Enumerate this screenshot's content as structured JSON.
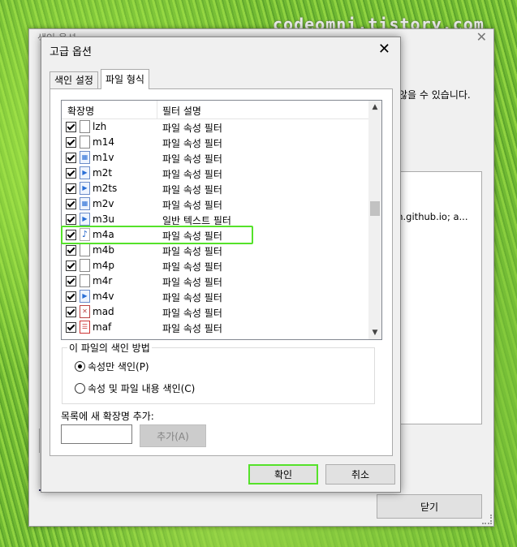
{
  "watermark": "codeomni.tistory.com",
  "background_window": {
    "title": "색인 옵션",
    "description_fragment": "않을 수 있습니다.",
    "list_fragment": "ian.github.io; a...",
    "close_button": "닫기"
  },
  "dialog": {
    "title": "고급 옵션",
    "tabs": [
      {
        "label": "색인 설정",
        "active": false
      },
      {
        "label": "파일 형식",
        "active": true
      }
    ],
    "list": {
      "columns": [
        "확장명",
        "필터 설명"
      ],
      "rows": [
        {
          "ext": "lzh",
          "filter": "파일 속성 필터",
          "icon": "blank-file-icon"
        },
        {
          "ext": "m14",
          "filter": "파일 속성 필터",
          "icon": "blank-file-icon"
        },
        {
          "ext": "m1v",
          "filter": "파일 속성 필터",
          "icon": "video-file-icon"
        },
        {
          "ext": "m2t",
          "filter": "파일 속성 필터",
          "icon": "media-file-icon"
        },
        {
          "ext": "m2ts",
          "filter": "파일 속성 필터",
          "icon": "media-file-icon"
        },
        {
          "ext": "m2v",
          "filter": "파일 속성 필터",
          "icon": "video-file-icon"
        },
        {
          "ext": "m3u",
          "filter": "일반 텍스트 필터",
          "icon": "media-file-icon"
        },
        {
          "ext": "m4a",
          "filter": "파일 속성 필터",
          "icon": "music-note-icon",
          "highlighted": true
        },
        {
          "ext": "m4b",
          "filter": "파일 속성 필터",
          "icon": "blank-file-icon"
        },
        {
          "ext": "m4p",
          "filter": "파일 속성 필터",
          "icon": "blank-file-icon"
        },
        {
          "ext": "m4r",
          "filter": "파일 속성 필터",
          "icon": "blank-file-icon"
        },
        {
          "ext": "m4v",
          "filter": "파일 속성 필터",
          "icon": "media-file-icon"
        },
        {
          "ext": "mad",
          "filter": "파일 속성 필터",
          "icon": "access-file-icon"
        },
        {
          "ext": "maf",
          "filter": "파일 속성 필터",
          "icon": "form-file-icon"
        }
      ]
    },
    "index_group": {
      "legend": "이 파일의 색인 방법",
      "option_properties": "속성만 색인(P)",
      "option_contents": "속성 및 파일 내용 색인(C)",
      "selected": "properties"
    },
    "add_extension": {
      "label": "목록에 새 확장명 추가:",
      "value": "",
      "button": "추가(A)"
    },
    "ok_button": "확인",
    "cancel_button": "취소"
  },
  "colors": {
    "highlight": "#55e22a"
  }
}
